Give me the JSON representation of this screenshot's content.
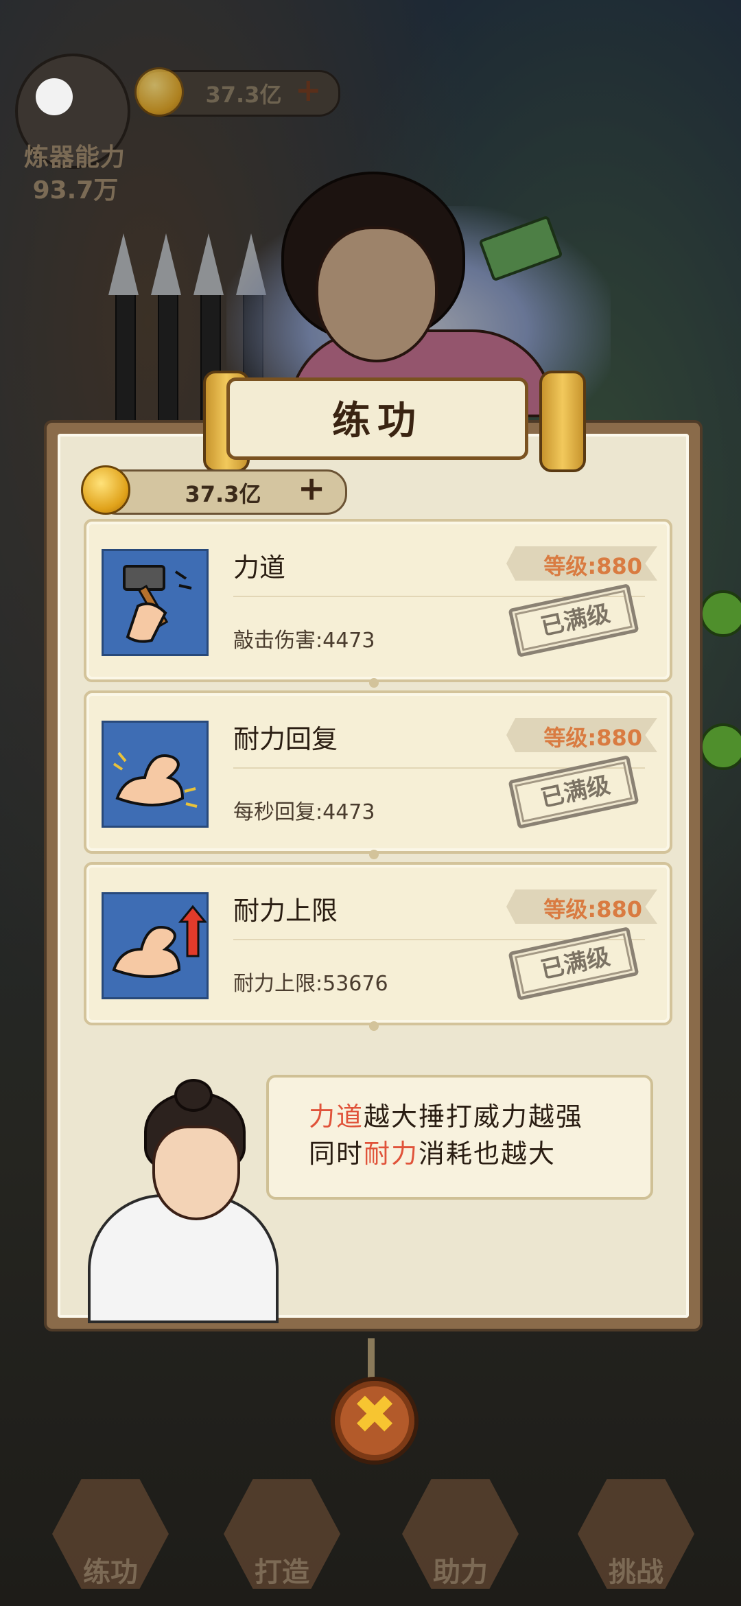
{
  "hud": {
    "coins": "37.3亿",
    "coin_plus": "+",
    "power_label": "炼器能力",
    "power_value": "93.7万"
  },
  "panel": {
    "title": "练功",
    "coins": "37.3亿",
    "coin_plus": "+",
    "skills": [
      {
        "name": "力道",
        "level": "等级:880",
        "effect": "敲击伤害:4473",
        "status": "已满级",
        "icon": "hammer-arm-icon"
      },
      {
        "name": "耐力回复",
        "level": "等级:880",
        "effect": "每秒回复:4473",
        "status": "已满级",
        "icon": "flex-arm-icon"
      },
      {
        "name": "耐力上限",
        "level": "等级:880",
        "effect": "耐力上限:53676",
        "status": "已满级",
        "icon": "flex-arm-up-icon"
      }
    ],
    "tip": {
      "line1_highlight": "力道",
      "line1_rest": "越大捶打威力越强",
      "line2_prefix": "同时",
      "line2_highlight": "耐力",
      "line2_rest": "消耗也越大"
    },
    "close_symbol": "✖"
  },
  "nav": [
    {
      "label": "练功",
      "icon": "training-icon"
    },
    {
      "label": "打造",
      "icon": "anvil-icon"
    },
    {
      "label": "助力",
      "icon": "helper-icon"
    },
    {
      "label": "挑战",
      "icon": "crossed-swords-icon"
    }
  ],
  "colors": {
    "accent_orange": "#d97b41",
    "highlight_red": "#e0533a",
    "panel_bg": "#ece6d0",
    "icon_bg": "#3e6db4"
  }
}
